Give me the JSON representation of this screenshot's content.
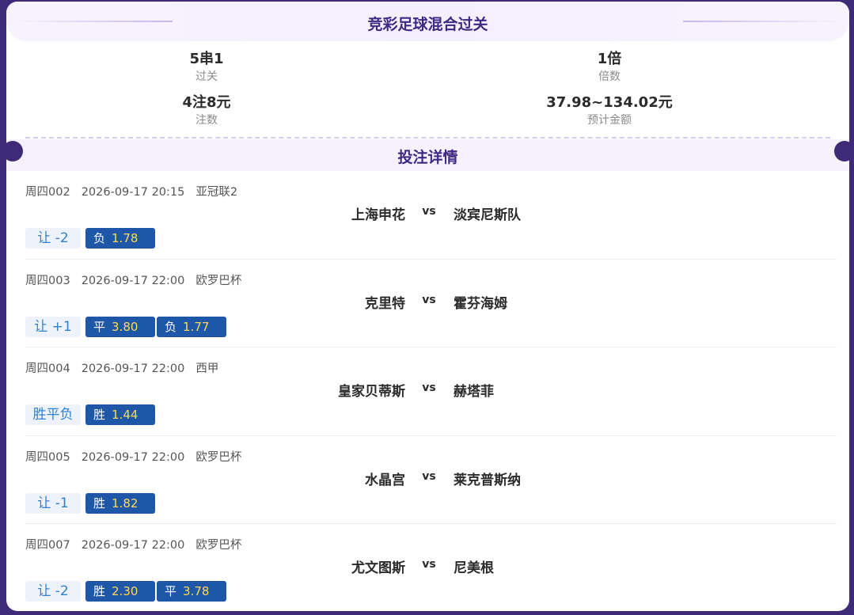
{
  "header": {
    "title": "竞彩足球混合过关"
  },
  "summary": {
    "pass_type": {
      "value": "5串1",
      "label": "过关"
    },
    "multiple": {
      "value": "1倍",
      "label": "倍数"
    },
    "bets": {
      "value": "4注8元",
      "label": "注数"
    },
    "amount": {
      "value": "37.98~134.02元",
      "label": "预计金额"
    }
  },
  "details": {
    "title": "投注详情"
  },
  "matches": [
    {
      "code": "周四002",
      "time": "2026-09-17 20:15",
      "league": "亚冠联2",
      "home": "上海申花",
      "vs": "vs",
      "away": "淡宾尼斯队",
      "play": "让 -2",
      "picks": [
        {
          "result": "负",
          "odd": "1.78"
        }
      ]
    },
    {
      "code": "周四003",
      "time": "2026-09-17 22:00",
      "league": "欧罗巴杯",
      "home": "克里特",
      "vs": "vs",
      "away": "霍芬海姆",
      "play": "让 +1",
      "picks": [
        {
          "result": "平",
          "odd": "3.80"
        },
        {
          "result": "负",
          "odd": "1.77"
        }
      ]
    },
    {
      "code": "周四004",
      "time": "2026-09-17 22:00",
      "league": "西甲",
      "home": "皇家贝蒂斯",
      "vs": "vs",
      "away": "赫塔菲",
      "play": "胜平负",
      "picks": [
        {
          "result": "胜",
          "odd": "1.44"
        }
      ]
    },
    {
      "code": "周四005",
      "time": "2026-09-17 22:00",
      "league": "欧罗巴杯",
      "home": "水晶宫",
      "vs": "vs",
      "away": "莱克普斯纳",
      "play": "让 -1",
      "picks": [
        {
          "result": "胜",
          "odd": "1.82"
        }
      ]
    },
    {
      "code": "周四007",
      "time": "2026-09-17 22:00",
      "league": "欧罗巴杯",
      "home": "尤文图斯",
      "vs": "vs",
      "away": "尼美根",
      "play": "让 -2",
      "picks": [
        {
          "result": "胜",
          "odd": "2.30"
        },
        {
          "result": "平",
          "odd": "3.78"
        }
      ]
    }
  ]
}
